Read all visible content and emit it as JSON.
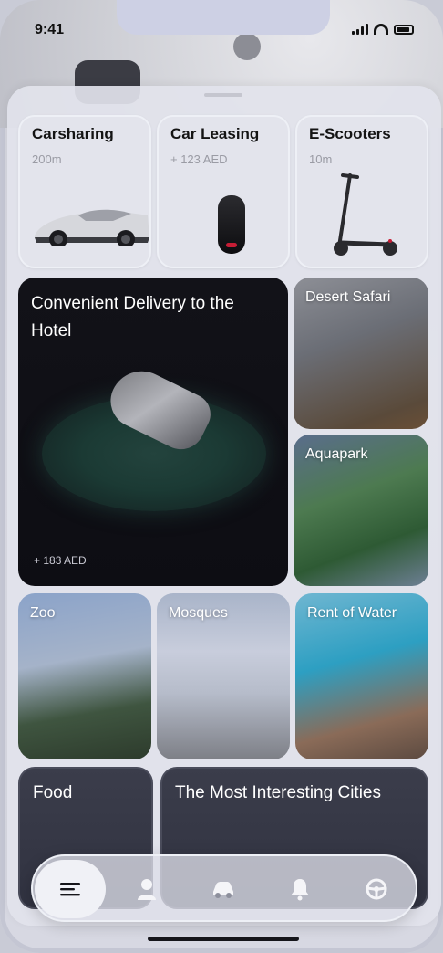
{
  "status_bar": {
    "time": "9:41"
  },
  "categories": [
    {
      "title": "Carsharing",
      "subtitle": "200m"
    },
    {
      "title": "Car Leasing",
      "subtitle": "+ 123 AED"
    },
    {
      "title": "E-Scooters",
      "subtitle": "10m"
    }
  ],
  "feature": {
    "title": "Convenient Delivery to the Hotel",
    "price": "+ 183 AED"
  },
  "tiles": {
    "desert_safari": "Desert Safari",
    "aquapark": "Aquapark",
    "zoo": "Zoo",
    "mosques": "Mosques",
    "rent_of_water": "Rent of Water"
  },
  "bottom_cards": {
    "food": "Food",
    "cities": "The Most Interesting Cities"
  },
  "tabbar": {
    "items": [
      {
        "icon": "menu-icon",
        "active": true
      },
      {
        "icon": "user-icon",
        "active": false
      },
      {
        "icon": "car-icon",
        "active": false
      },
      {
        "icon": "bell-icon",
        "active": false
      },
      {
        "icon": "steering-wheel-icon",
        "active": false
      }
    ]
  },
  "colors": {
    "accent_red": "#c61d35",
    "card_dark": "#121218",
    "sheet": "#e2e3ec"
  }
}
